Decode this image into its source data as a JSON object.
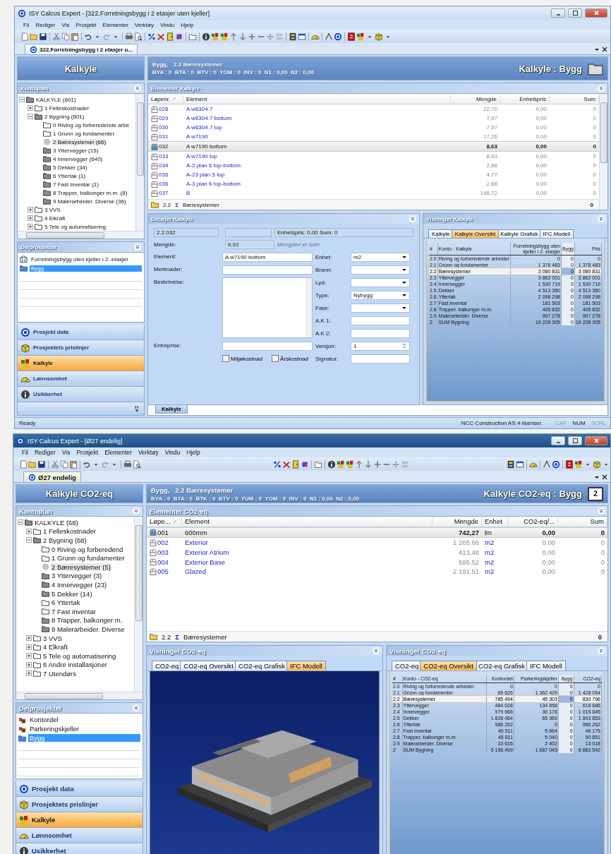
{
  "windows": [
    {
      "active": false,
      "title": "ISY Calcus Expert - [322.Forretningsbygg i 2 etasjer uten kjeller]",
      "menu": [
        "Fil",
        "Rediger",
        "Vis",
        "Prosjekt",
        "Elementer",
        "Verktøy",
        "Vindu",
        "Hjelp"
      ],
      "document_tab": "322.Forretningsbygg i 2 etasjer u...",
      "module_title": "Kalkyle",
      "account_plan": {
        "title": "Kontoplan",
        "tree": [
          {
            "label": "KALKYLE (801)",
            "kind": "folder-filled",
            "expanded": true,
            "selected": false,
            "children": [
              {
                "label": "1 Felleskostnader",
                "kind": "folder",
                "expanded": false,
                "selected": false
              },
              {
                "label": "2 Bygning (801)",
                "kind": "folder-filled",
                "expanded": true,
                "selected": false,
                "children": [
                  {
                    "label": "0 Riving og forberedende arbe",
                    "kind": "folder",
                    "selected": false
                  },
                  {
                    "label": "1 Grunn og fundamenter",
                    "kind": "folder",
                    "selected": false
                  },
                  {
                    "label": "2 Bæresystemer (66)",
                    "kind": "account",
                    "selected": true
                  },
                  {
                    "label": "3 Yttervegger (15)",
                    "kind": "folder-filled",
                    "selected": false
                  },
                  {
                    "label": "4 Innervegger (640)",
                    "kind": "folder-filled",
                    "selected": false
                  },
                  {
                    "label": "5 Dekker (34)",
                    "kind": "folder-filled",
                    "selected": false
                  },
                  {
                    "label": "6 Yttertak (1)",
                    "kind": "folder-filled",
                    "selected": false
                  },
                  {
                    "label": "7 Fast inventar (1)",
                    "kind": "folder-filled",
                    "selected": false
                  },
                  {
                    "label": "8 Trapper, balkonger m.m. (8)",
                    "kind": "folder-filled",
                    "selected": false
                  },
                  {
                    "label": "9 Malerarbeider. Diverse (36)",
                    "kind": "folder-filled",
                    "selected": false
                  }
                ]
              },
              {
                "label": "3 VVS",
                "kind": "folder",
                "expanded": false,
                "selected": false
              },
              {
                "label": "4 Elkraft",
                "kind": "folder",
                "expanded": false,
                "selected": false
              },
              {
                "label": "5 Tele og automatisering",
                "kind": "folder",
                "expanded": false,
                "selected": false
              }
            ]
          }
        ]
      },
      "subprojects": {
        "title": "Delprosjekter",
        "items": [
          {
            "label": "Forretningsbygg uten kjeller i 2. etasjer",
            "kind": "building",
            "selected": false
          },
          {
            "label": "Bygg",
            "kind": "folder",
            "selected": true
          }
        ]
      },
      "nav": [
        {
          "label": "Prosjekt data",
          "selected": false
        },
        {
          "label": "Prosjektets prislinjer",
          "selected": false
        },
        {
          "label": "Kalkyle",
          "selected": true
        },
        {
          "label": "Lønnsomhet",
          "selected": false
        },
        {
          "label": "Usikkerhet",
          "selected": false
        }
      ],
      "more_button": true,
      "header": {
        "object": "Bygg,",
        "account": "2.2 Bæresystemer",
        "stats": "BYA : 0  BTA : 0  BTV : 0  YOM : 0  INV : 0  N1 : 0,00  N2 : 0,00",
        "title": "Kalkyle : Bygg"
      },
      "elements": {
        "title": "Elementer Kalkyle",
        "scrollable": true,
        "columns": [
          {
            "label": "Løpenr.",
            "numeric": false
          },
          {
            "label": "Element",
            "numeric": false
          },
          {
            "label": "Mengde",
            "numeric": true
          },
          {
            "label": "Enhetspris",
            "numeric": true
          },
          {
            "label": "Sum",
            "numeric": true
          }
        ],
        "rows": [
          {
            "cells": [
              "028",
              "A w6304.7",
              "22,70",
              "0,00",
              "0"
            ],
            "selected": false
          },
          {
            "cells": [
              "029",
              "A w6304.7 bottom",
              "7,57",
              "0,00",
              "0"
            ],
            "selected": false
          },
          {
            "cells": [
              "030",
              "A w6304.7 top",
              "7,57",
              "0,00",
              "0"
            ],
            "selected": false
          },
          {
            "cells": [
              "031",
              "A w7190",
              "17,26",
              "0,00",
              "0"
            ],
            "selected": false
          },
          {
            "cells": [
              "032",
              "A w7190 bottom",
              "8,63",
              "0,00",
              "0"
            ],
            "selected": true
          },
          {
            "cells": [
              "033",
              "A w7190 top",
              "8,63",
              "0,00",
              "0"
            ],
            "selected": false
          },
          {
            "cells": [
              "034",
              "A-2 plan 6 top-bottom",
              "2,88",
              "0,00",
              "0"
            ],
            "selected": false
          },
          {
            "cells": [
              "035",
              "A-23 plan 5 top",
              "4,77",
              "0,00",
              "0"
            ],
            "selected": false
          },
          {
            "cells": [
              "036",
              "A-3 plan 6 top-bottom",
              "2,88",
              "0,00",
              "0"
            ],
            "selected": false
          },
          {
            "cells": [
              "037",
              "B",
              "198,72",
              "0,00",
              "0"
            ],
            "selected": false
          }
        ],
        "summary": {
          "code": "2.2",
          "sigma": "Σ",
          "label": "Bæresystemer",
          "sum": "0"
        }
      },
      "panels": [
        {
          "kind": "details",
          "title": "Detaljer Kalkyle",
          "code": "2.2.032",
          "info": "Enhetspris: 0,00  Sum: 0",
          "quantity": {
            "label": "Mengde:",
            "value": "8,63",
            "note": "Mengden er sum"
          },
          "left_fields": [
            {
              "label": "Element:",
              "kind": "input",
              "value": "A w7190 bottom"
            },
            {
              "label": "Merknader:",
              "kind": "input"
            },
            {
              "label": "Beskrivelse:",
              "kind": "textarea"
            },
            {
              "label": "Entreprise:",
              "kind": "input"
            }
          ],
          "right_fields": [
            {
              "label": "Enhet:",
              "kind": "select",
              "value": "m2"
            },
            {
              "label": "Brann:",
              "kind": "select"
            },
            {
              "label": "Lyd:",
              "kind": "select"
            },
            {
              "label": "Type:",
              "kind": "select",
              "value": "Nybygg"
            },
            {
              "label": "Fase:",
              "kind": "select"
            },
            {
              "label": "A.K 1:",
              "kind": "input"
            },
            {
              "label": "A.K 2:",
              "kind": "input"
            },
            {
              "label": "Versjon:",
              "kind": "spin",
              "value": "1"
            },
            {
              "label": "Signatur:",
              "kind": "input"
            }
          ],
          "checkboxes": [
            {
              "label": "Miljøkostnad",
              "checked": false
            },
            {
              "label": "Årskostnad",
              "checked": false
            }
          ]
        },
        {
          "kind": "views",
          "title": "Visninger Kalkyle",
          "tabs": [
            {
              "label": "Kalkyle",
              "selected": false
            },
            {
              "label": "Kalkyle Oversikt",
              "selected": true
            },
            {
              "label": "Kalkyle Grafisk",
              "selected": false
            },
            {
              "label": "IFC Modell",
              "selected": false
            }
          ],
          "content": {
            "kind": "table",
            "columns": [
              {
                "label": "#",
                "highlighted": false
              },
              {
                "label": "Konto - Kalkyle",
                "highlighted": false
              },
              {
                "label": "Forretningsbygg uten kjeller i 2. etasjer",
                "highlighted": false
              },
              {
                "label": "Bygg",
                "highlighted": true
              },
              {
                "label": "Pris",
                "highlighted": false
              }
            ],
            "rows": [
              {
                "cells": [
                  "2.0",
                  "Riving og forberedende arbeider",
                  "0",
                  "0",
                  "0"
                ],
                "selected": false
              },
              {
                "cells": [
                  "2.1",
                  "Grunn og fundamenter",
                  "1 378 483",
                  "0",
                  "1 378 483"
                ],
                "selected": false
              },
              {
                "cells": [
                  "2.2",
                  "Bæresystemer",
                  "3 080 831",
                  "0",
                  "3 080 831"
                ],
                "selected": true
              },
              {
                "cells": [
                  "2.3",
                  "Yttervegger",
                  "3 862 001",
                  "0",
                  "3 862 001"
                ],
                "selected": false
              },
              {
                "cells": [
                  "2.4",
                  "Innervegger",
                  "1 530 719",
                  "0",
                  "1 530 719"
                ],
                "selected": false
              },
              {
                "cells": [
                  "2.5",
                  "Dekker",
                  "4 513 350",
                  "0",
                  "4 513 350"
                ],
                "selected": false
              },
              {
                "cells": [
                  "2.6",
                  "Yttertak",
                  "2 098 298",
                  "0",
                  "2 098 298"
                ],
                "selected": false
              },
              {
                "cells": [
                  "2.7",
                  "Fast inventar",
                  "181 503",
                  "0",
                  "181 503"
                ],
                "selected": false
              },
              {
                "cells": [
                  "2.8",
                  "Trapper, balkonger m.m.",
                  "405 832",
                  "0",
                  "405 832"
                ],
                "selected": false
              },
              {
                "cells": [
                  "2.9",
                  "Malerarbeider. Diverse",
                  "907 278",
                  "0",
                  "907 278"
                ],
                "selected": false
              },
              {
                "cells": [
                  "2",
                  "SUM Bygning",
                  "19 228 305",
                  "0",
                  "19 228 305"
                ],
                "selected": false
              }
            ]
          }
        }
      ],
      "bottom_tabs": [
        {
          "label": "Kalkyle",
          "selected": true
        }
      ],
      "status_bar": {
        "text": "Ready",
        "license": "NCC Construction AS 4 lisenser.",
        "indicators": [
          {
            "label": "CAP",
            "on": false
          },
          {
            "label": "NUM",
            "on": true
          },
          {
            "label": "SCRL",
            "on": false
          }
        ]
      }
    },
    {
      "active": true,
      "title": "ISY Calcus Expert - [Ø27 endelig]",
      "menu": [
        "Fil",
        "Rediger",
        "Vis",
        "Prosjekt",
        "Elementer",
        "Verktøy",
        "Vindu",
        "Hjelp"
      ],
      "document_tab": "Ø27 endelig",
      "module_title": "Kalkyle CO2-eq",
      "account_plan": {
        "title": "Kontoplan",
        "tree": [
          {
            "label": "KALKYLE (68)",
            "kind": "folder-filled",
            "expanded": true,
            "selected": false,
            "children": [
              {
                "label": "1 Felleskostnader",
                "kind": "folder",
                "expanded": false,
                "selected": false
              },
              {
                "label": "2 Bygning (68)",
                "kind": "folder-filled",
                "expanded": true,
                "selected": false,
                "children": [
                  {
                    "label": "0 Riving og forberedend",
                    "kind": "folder",
                    "selected": false
                  },
                  {
                    "label": "1 Grunn og fundamenter",
                    "kind": "folder",
                    "selected": false
                  },
                  {
                    "label": "2 Bæresystemer (5)",
                    "kind": "account",
                    "selected": true
                  },
                  {
                    "label": "3 Yttervegger (3)",
                    "kind": "folder-filled",
                    "selected": false
                  },
                  {
                    "label": "4 Innervegger (23)",
                    "kind": "folder-filled",
                    "selected": false
                  },
                  {
                    "label": "5 Dekker (14)",
                    "kind": "folder-filled",
                    "selected": false
                  },
                  {
                    "label": "6 Yttertak",
                    "kind": "folder",
                    "selected": false
                  },
                  {
                    "label": "7 Fast inventar",
                    "kind": "folder",
                    "selected": false
                  },
                  {
                    "label": "8 Trapper, balkonger m.",
                    "kind": "folder-filled",
                    "selected": false
                  },
                  {
                    "label": "9 Malerarbeider. Diverse",
                    "kind": "folder-filled",
                    "selected": false
                  }
                ]
              },
              {
                "label": "3 VVS",
                "kind": "folder",
                "expanded": false,
                "selected": false
              },
              {
                "label": "4 Elkraft",
                "kind": "folder",
                "expanded": false,
                "selected": false
              },
              {
                "label": "5 Tele og automatisering",
                "kind": "folder",
                "expanded": false,
                "selected": false
              },
              {
                "label": "6 Andre installasjoner",
                "kind": "folder",
                "expanded": false,
                "selected": false
              },
              {
                "label": "7 Utendørs",
                "kind": "folder",
                "expanded": false,
                "selected": false
              }
            ]
          }
        ]
      },
      "subprojects": {
        "title": "Delprosjekter",
        "items": [
          {
            "label": "Kontordel",
            "kind": "part",
            "selected": false
          },
          {
            "label": "Parkeringskjeller",
            "kind": "part",
            "selected": false
          },
          {
            "label": "Bygg",
            "kind": "folder",
            "selected": true
          }
        ]
      },
      "nav": [
        {
          "label": "Prosjekt data",
          "selected": false
        },
        {
          "label": "Prosjektets prislinjer",
          "selected": false
        },
        {
          "label": "Kalkyle",
          "selected": true
        },
        {
          "label": "Lønnsomhet",
          "selected": false
        },
        {
          "label": "Usikkerhet",
          "selected": false
        }
      ],
      "header": {
        "object": "Bygg,",
        "account": "2.2 Bæresystemer",
        "stats": "BYA : 0  BTA : 0  BTK : 0  BTV : 0  YUM : 0  YOM : 0  INV : 0  N1 : 0,00  N2 : 0,00",
        "title": "Kalkyle CO2-eq : Bygg",
        "badge": "2"
      },
      "elements": {
        "title": "Elementer CO2-eq",
        "scrollable": false,
        "columns": [
          {
            "label": "Løpe...",
            "numeric": false
          },
          {
            "label": "Element",
            "numeric": false
          },
          {
            "label": "Mengde",
            "numeric": true
          },
          {
            "label": "Enhet",
            "numeric": false
          },
          {
            "label": "CO2-eq/...",
            "numeric": true
          },
          {
            "label": "Sum",
            "numeric": true
          }
        ],
        "rows": [
          {
            "cells": [
              "001",
              "600mm",
              "742,27",
              "lm",
              "0,00",
              "0"
            ],
            "selected": true
          },
          {
            "cells": [
              "002",
              "Exterior",
              "1 265,66",
              "m2",
              "0,00",
              "0"
            ],
            "selected": false
          },
          {
            "cells": [
              "003",
              "Exterior Atrium",
              "413,48",
              "m2",
              "0,00",
              "0"
            ],
            "selected": false
          },
          {
            "cells": [
              "004",
              "Exterior Base",
              "595,52",
              "m2",
              "0,00",
              "0"
            ],
            "selected": false
          },
          {
            "cells": [
              "005",
              "Glazed",
              "2 191,51",
              "m2",
              "0,00",
              "0"
            ],
            "selected": false
          }
        ],
        "summary": {
          "code": "2.2",
          "sigma": "Σ",
          "label": "Bæresystemer",
          "sum": "0"
        }
      },
      "panels": [
        {
          "kind": "views",
          "title": "Visninger CO2-eq",
          "tabs": [
            {
              "label": "CO2-eq",
              "selected": false
            },
            {
              "label": "CO2-eq Oversikt",
              "selected": false
            },
            {
              "label": "CO2-eq Grafisk",
              "selected": false
            },
            {
              "label": "IFC Modell",
              "selected": true
            }
          ],
          "content": {
            "kind": "picture"
          }
        },
        {
          "kind": "views",
          "title": "Visninger CO2-eq",
          "tabs": [
            {
              "label": "CO2-eq",
              "selected": false
            },
            {
              "label": "CO2-eq Oversikt",
              "selected": true
            },
            {
              "label": "CO2-eq Grafisk",
              "selected": false
            },
            {
              "label": "IFC Modell",
              "selected": false
            }
          ],
          "content": {
            "kind": "table",
            "columns": [
              {
                "label": "#",
                "highlighted": false
              },
              {
                "label": "Konto - CO2-eq",
                "highlighted": false
              },
              {
                "label": "Kontordel",
                "highlighted": false
              },
              {
                "label": "Parkeringskjeller",
                "highlighted": false
              },
              {
                "label": "Bygg",
                "highlighted": true
              },
              {
                "label": "CO2-eq",
                "highlighted": false
              }
            ],
            "rows": [
              {
                "cells": [
                  "2.0",
                  "Riving og forberedende arbeider",
                  "0",
                  "0",
                  "0",
                  "0"
                ],
                "selected": false
              },
              {
                "cells": [
                  "2.1",
                  "Grunn og fundamenter",
                  "65 626",
                  "1 362 429",
                  "0",
                  "1 428 054"
                ],
                "selected": false
              },
              {
                "cells": [
                  "2.2",
                  "Bæresystemer",
                  "785 494",
                  "45 303",
                  "0",
                  "830 796"
                ],
                "selected": true
              },
              {
                "cells": [
                  "2.3",
                  "Yttervegger",
                  "484 028",
                  "134 658",
                  "0",
                  "618 686"
                ],
                "selected": false
              },
              {
                "cells": [
                  "2.4",
                  "Innervegger",
                  "979 666",
                  "36 178",
                  "0",
                  "1 015 845"
                ],
                "selected": false
              },
              {
                "cells": [
                  "2.5",
                  "Dekker",
                  "1 828 484",
                  "65 369",
                  "0",
                  "1 893 853"
                ],
                "selected": false
              },
              {
                "cells": [
                  "2.6",
                  "Yttertak",
                  "986 262",
                  "0",
                  "0",
                  "986 262"
                ],
                "selected": false
              },
              {
                "cells": [
                  "2.7",
                  "Fast inventar",
                  "40 511",
                  "5 664",
                  "0",
                  "46 175"
                ],
                "selected": false
              },
              {
                "cells": [
                  "2.8",
                  "Trapper, balkonger m.m.",
                  "45 811",
                  "5 040",
                  "0",
                  "50 851"
                ],
                "selected": false
              },
              {
                "cells": [
                  "2.9",
                  "Malerarbeider. Diverse",
                  "10 616",
                  "2 402",
                  "0",
                  "13 018"
                ],
                "selected": false
              },
              {
                "cells": [
                  "2",
                  "SUM Bygning",
                  "5 196 499",
                  "1 687 043",
                  "0",
                  "6 883 542"
                ],
                "selected": false
              }
            ]
          }
        }
      ]
    }
  ]
}
